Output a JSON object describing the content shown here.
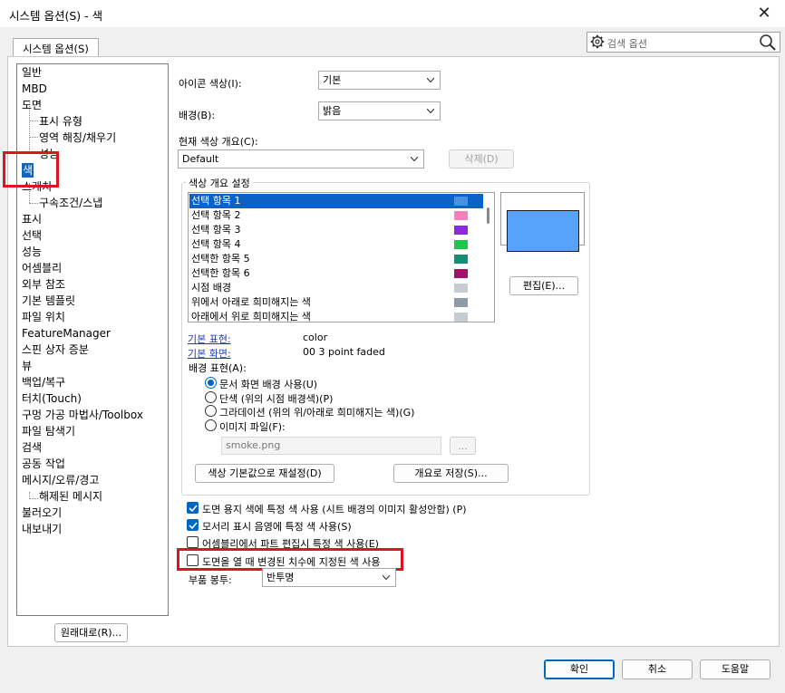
{
  "window": {
    "title": "시스템 옵션(S) - 색",
    "close_symbol": "✕"
  },
  "tab": {
    "label": "시스템 옵션(S)"
  },
  "search": {
    "placeholder": "검색 옵션"
  },
  "tree": {
    "items": [
      {
        "label": "일반",
        "level": 0
      },
      {
        "label": "MBD",
        "level": 0
      },
      {
        "label": "도면",
        "level": 0
      },
      {
        "label": "표시 유형",
        "level": 1
      },
      {
        "label": "영역 해칭/채우기",
        "level": 1
      },
      {
        "label": "성능",
        "level": 1
      },
      {
        "label": "색",
        "level": 0,
        "selected": true
      },
      {
        "label": "스케치",
        "level": 0
      },
      {
        "label": "구속조건/스냅",
        "level": 1
      },
      {
        "label": "표시",
        "level": 0
      },
      {
        "label": "선택",
        "level": 0
      },
      {
        "label": "성능",
        "level": 0
      },
      {
        "label": "어셈블리",
        "level": 0
      },
      {
        "label": "외부 참조",
        "level": 0
      },
      {
        "label": "기본 템플릿",
        "level": 0
      },
      {
        "label": "파일 위치",
        "level": 0
      },
      {
        "label": "FeatureManager",
        "level": 0
      },
      {
        "label": "스핀 상자 증분",
        "level": 0
      },
      {
        "label": "뷰",
        "level": 0
      },
      {
        "label": "백업/복구",
        "level": 0
      },
      {
        "label": "터치(Touch)",
        "level": 0
      },
      {
        "label": "구멍 가공 마법사/Toolbox",
        "level": 0
      },
      {
        "label": "파일 탐색기",
        "level": 0
      },
      {
        "label": "검색",
        "level": 0
      },
      {
        "label": "공동 작업",
        "level": 0
      },
      {
        "label": "메시지/오류/경고",
        "level": 0
      },
      {
        "label": "해제된 메시지",
        "level": 1
      },
      {
        "label": "불러오기",
        "level": 0
      },
      {
        "label": "내보내기",
        "level": 0
      }
    ],
    "reset_button": "원래대로(R)..."
  },
  "settings": {
    "icon_color_label": "아이콘 색상(I):",
    "icon_color_value": "기본",
    "background_label": "배경(B):",
    "background_value": "밝음",
    "scheme_label": "현재 색상 개요(C):",
    "scheme_value": "Default",
    "delete_button": "삭제(D)",
    "group_title": "색상 개요 설정",
    "color_items": [
      {
        "label": "선택 항목 1",
        "color": "#4a90e2",
        "selected": true
      },
      {
        "label": "선택 항목 2",
        "color": "#f77fbe"
      },
      {
        "label": "선택 항목 3",
        "color": "#8a2be2"
      },
      {
        "label": "선택 항목 4",
        "color": "#1ec74a"
      },
      {
        "label": "선택한 항목 5",
        "color": "#138f77"
      },
      {
        "label": "선택한 항목 6",
        "color": "#a3136b"
      },
      {
        "label": "시점 배경",
        "color": "#c5ccd4"
      },
      {
        "label": "위에서 아래로 희미해지는 색",
        "color": "#8f9aa7"
      },
      {
        "label": "아래에서 위로 희미해지는 색",
        "color": "#c6ccd4"
      }
    ],
    "preview_color": "#57a3fb",
    "edit_button": "편집(E)...",
    "default_appearance_label": "기본 표현:",
    "default_appearance_value": "color",
    "default_scene_label": "기본 화면:",
    "default_scene_value": "00 3 point faded",
    "bg_appearance_label": "배경 표현(A):",
    "radios": [
      {
        "label": "문서 화면 배경 사용(U)",
        "checked": true
      },
      {
        "label": "단색 (위의 시점 배경색)(P)",
        "checked": false
      },
      {
        "label": "그라데이션 (위의 위/아래로 희미해지는 색)(G)",
        "checked": false
      },
      {
        "label": "이미지 파일(F):",
        "checked": false
      }
    ],
    "image_file_value": "smoke.png",
    "browse_button": "...",
    "reset_colors_button": "색상 기본값으로 재설정(D)",
    "save_scheme_button": "개요로 저장(S)...",
    "checkboxes": [
      {
        "label": "도면 용지 색에 특정 색 사용 (시트 배경의 이미지 활성안함) (P)",
        "checked": true
      },
      {
        "label": "모서리 표시 음영에 특정 색 사용(S)",
        "checked": true
      },
      {
        "label": "어셈블리에서 파트 편집시 특정 색 사용(E)",
        "checked": false
      },
      {
        "label": "도면을 열 때 변경된 치수에 지정된 색 사용",
        "checked": false
      }
    ],
    "envelope_label": "부품 봉투:",
    "envelope_value": "반투명"
  },
  "footer": {
    "ok": "확인",
    "cancel": "취소",
    "help": "도움말"
  },
  "colors": {
    "accent": "#0067c0",
    "highlight_box": "#e0141e",
    "selection": "#0b61c6"
  }
}
